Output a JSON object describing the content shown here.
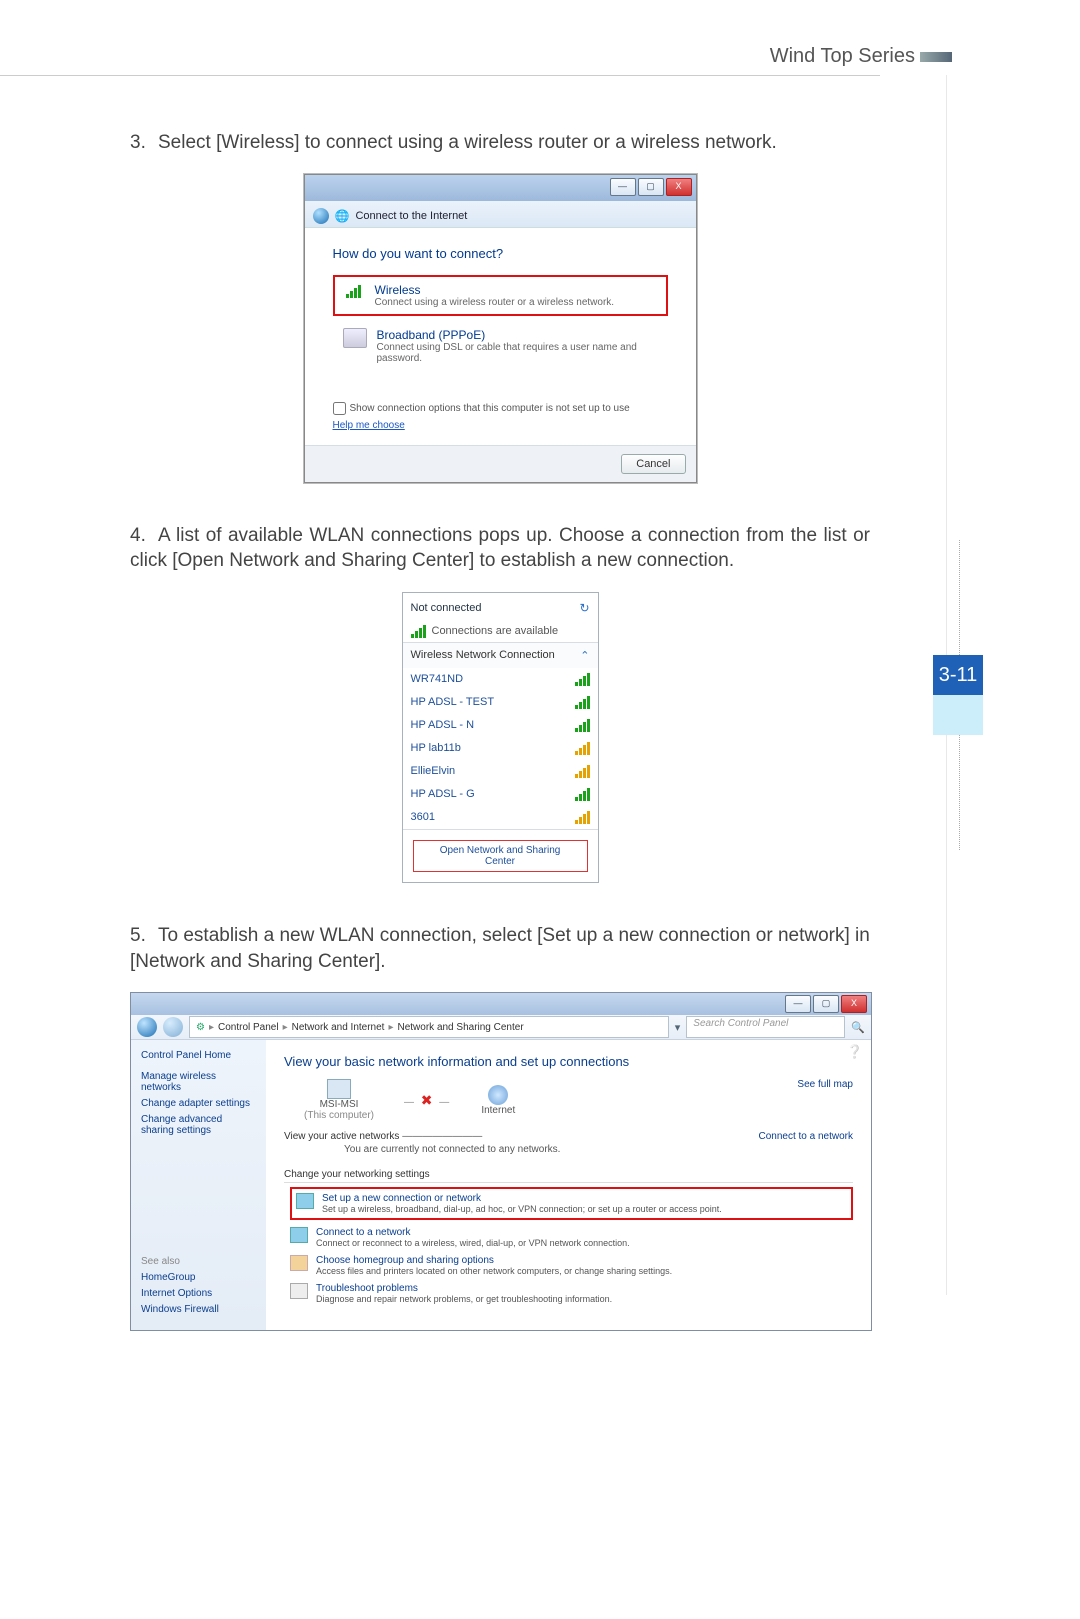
{
  "header": {
    "series": "Wind Top Series",
    "page_number": "3-11"
  },
  "step3": {
    "num": "3.",
    "text": "Select [Wireless] to connect using a wireless router or a wireless network."
  },
  "fig1": {
    "breadcrumb_icon": "←",
    "breadcrumb": "Connect to the Internet",
    "question": "How do you want to connect?",
    "wireless_title": "Wireless",
    "wireless_sub": "Connect using a wireless router or a wireless network.",
    "pppoe_title": "Broadband (PPPoE)",
    "pppoe_sub": "Connect using DSL or cable that requires a user name and password.",
    "show_options": "Show connection options that this computer is not set up to use",
    "help": "Help me choose",
    "cancel": "Cancel",
    "min": "—",
    "max": "▢",
    "close": "X"
  },
  "step4": {
    "num": "4.",
    "text": "A list of available WLAN connections pops up. Choose a connection from the list or click [Open Network and Sharing Center] to establish a new connection."
  },
  "fig2": {
    "not_connected": "Not connected",
    "available": "Connections are available",
    "section": "Wireless Network Connection",
    "chevron": "⌃",
    "refresh": "↻",
    "networks": [
      "WR741ND",
      "HP ADSL - TEST",
      "HP ADSL - N",
      "HP lab11b",
      "EllieElvin",
      "HP ADSL - G",
      "3601"
    ],
    "open_link": "Open Network and Sharing Center"
  },
  "step5": {
    "num": "5.",
    "text": "To establish a new WLAN connection, select [Set up a new connection or network] in [Network and Sharing Center]."
  },
  "fig3": {
    "min": "—",
    "max": "▢",
    "close": "X",
    "crumbs": [
      "Control Panel",
      "Network and Internet",
      "Network and Sharing Center"
    ],
    "search_placeholder": "Search Control Panel",
    "side_home": "Control Panel Home",
    "side_links": [
      "Manage wireless networks",
      "Change adapter settings",
      "Change advanced sharing settings"
    ],
    "see_also": "See also",
    "see_links": [
      "HomeGroup",
      "Internet Options",
      "Windows Firewall"
    ],
    "main_heading": "View your basic network information and set up connections",
    "see_full_map": "See full map",
    "node_pc": "MSI-MSI",
    "node_pc_sub": "(This computer)",
    "node_internet": "Internet",
    "active_label": "View your active networks",
    "active_msg": "You are currently not connected to any networks.",
    "connect_to": "Connect to a network",
    "change_hd": "Change your networking settings",
    "task1_t": "Set up a new connection or network",
    "task1_s": "Set up a wireless, broadband, dial-up, ad hoc, or VPN connection; or set up a router or access point.",
    "task2_t": "Connect to a network",
    "task2_s": "Connect or reconnect to a wireless, wired, dial-up, or VPN network connection.",
    "task3_t": "Choose homegroup and sharing options",
    "task3_s": "Access files and printers located on other network computers, or change sharing settings.",
    "task4_t": "Troubleshoot problems",
    "task4_s": "Diagnose and repair network problems, or get troubleshooting information."
  }
}
